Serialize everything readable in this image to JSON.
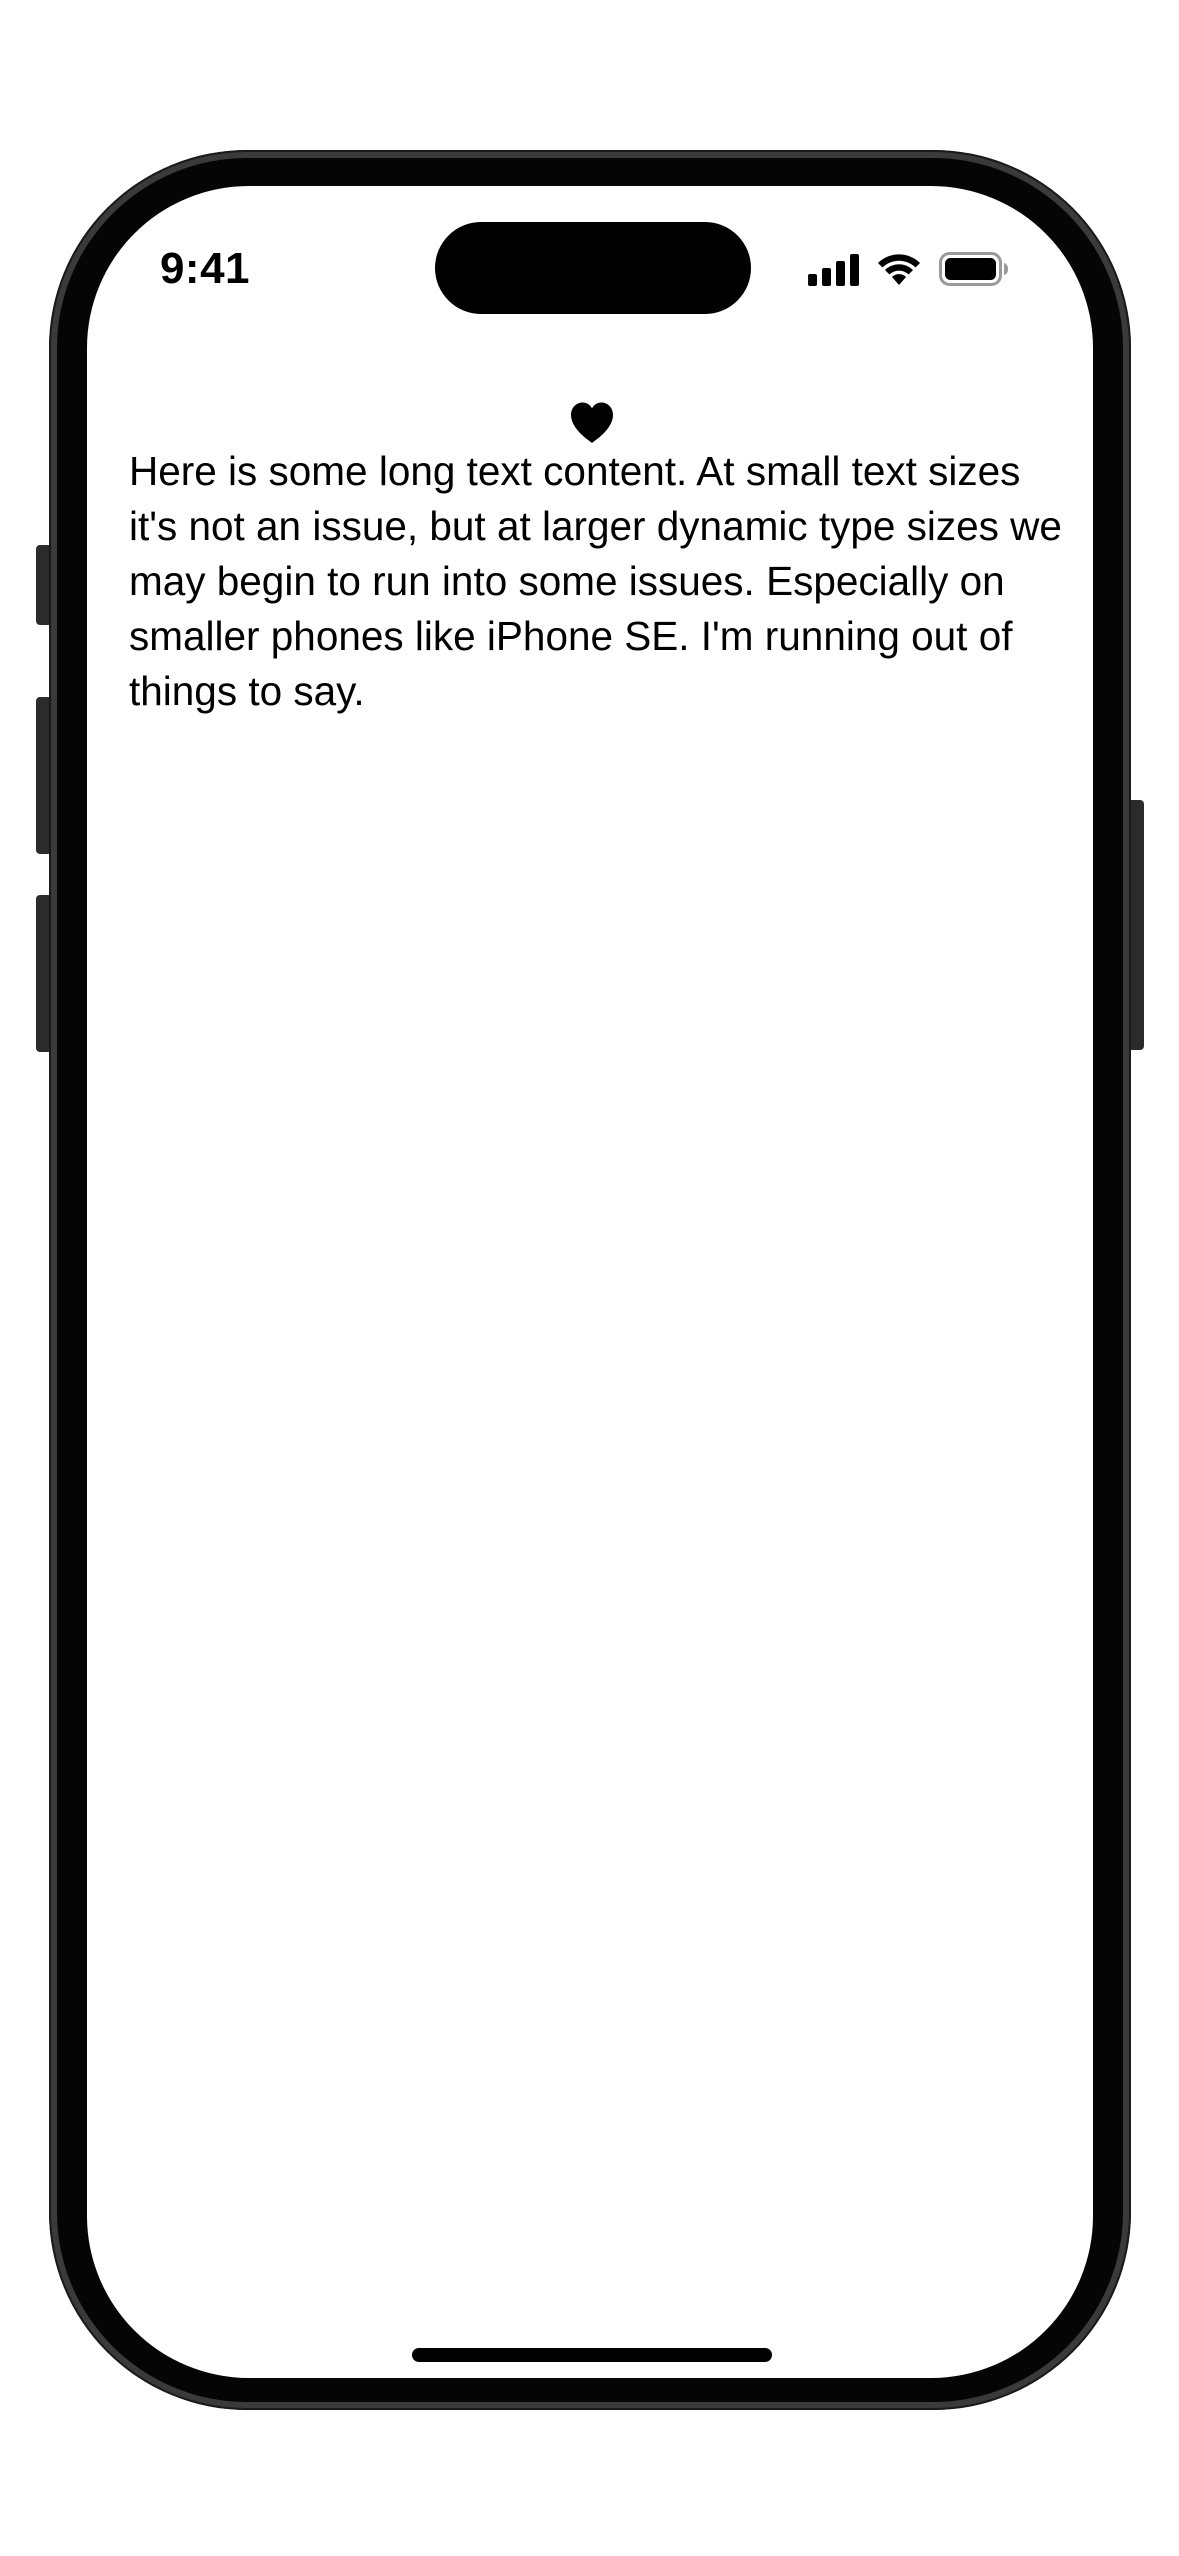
{
  "status_bar": {
    "time": "9:41",
    "signal_icon": "cellular-signal-icon",
    "wifi_icon": "wifi-icon",
    "battery_icon": "battery-icon"
  },
  "content": {
    "icon": "heart-icon",
    "text": "Here is some long text content. At small text sizes it's not an issue, but at larger dynamic type sizes we may begin to run into some issues. Especially on smaller phones like iPhone SE. I'm running out of things to say."
  },
  "colors": {
    "frame": "#3a3a3a",
    "bezel": "#050505",
    "screen": "#ffffff",
    "text": "#000000"
  }
}
